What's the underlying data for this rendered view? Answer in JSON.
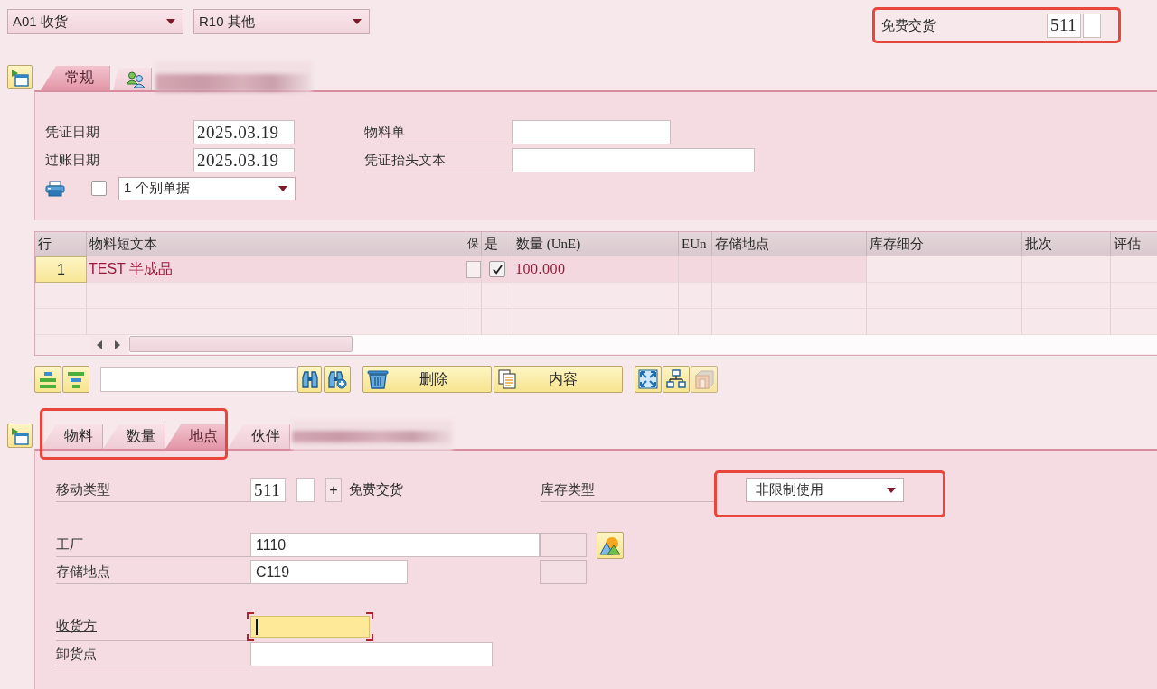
{
  "top_bar": {
    "dropdowns": [
      {
        "value": "A01 收货"
      },
      {
        "value": "R10 其他"
      }
    ],
    "movement": {
      "label": "免费交货",
      "code": "511",
      "highlighted": true
    }
  },
  "header": {
    "tabs": [
      {
        "kind": "text",
        "label": "常规",
        "selected": true
      },
      {
        "kind": "icon",
        "selected": false
      }
    ],
    "blurred_tab": true,
    "rows_left": [
      {
        "label": "凭证日期",
        "value": "2025.03.19"
      },
      {
        "label": "过账日期",
        "value": "2025.03.19"
      }
    ],
    "rows_right": [
      {
        "label": "物料单"
      },
      {
        "label": "凭证抬头文本"
      }
    ],
    "print_checked": false,
    "output": {
      "value": "1 个别单据"
    }
  },
  "table": {
    "columns": [
      "行",
      "物料短文本",
      "保",
      "是",
      "数量 (UnE)",
      "EUn",
      "存储地点",
      "库存细分",
      "批次",
      "评估"
    ],
    "rows": [
      {
        "line": "1",
        "material_text": "TEST 半成品",
        "check_a": false,
        "check_b": true,
        "quantity": "100.000",
        "selected": true
      }
    ]
  },
  "toolbar": {
    "buttons": [
      {
        "label": "删除"
      },
      {
        "label": "内容"
      }
    ]
  },
  "detail": {
    "tabs": [
      {
        "label": "物料",
        "selected": false
      },
      {
        "label": "数量",
        "selected": false
      },
      {
        "label": "地点",
        "selected": true
      },
      {
        "label": "伙伴",
        "selected": false
      }
    ],
    "tabs_highlighted": true,
    "blurred_tab": true,
    "movement": {
      "label": "移动类型",
      "code": "511",
      "plus": "+",
      "text": "免费交货"
    },
    "stock_type": {
      "label": "库存类型",
      "value": "非限制使用",
      "highlighted": true
    },
    "fields": [
      {
        "label": "工厂",
        "value": "1110"
      },
      {
        "label": "存储地点",
        "value": "C119"
      },
      {
        "label": "收货方",
        "focused": true
      },
      {
        "label": "卸货点"
      }
    ]
  }
}
